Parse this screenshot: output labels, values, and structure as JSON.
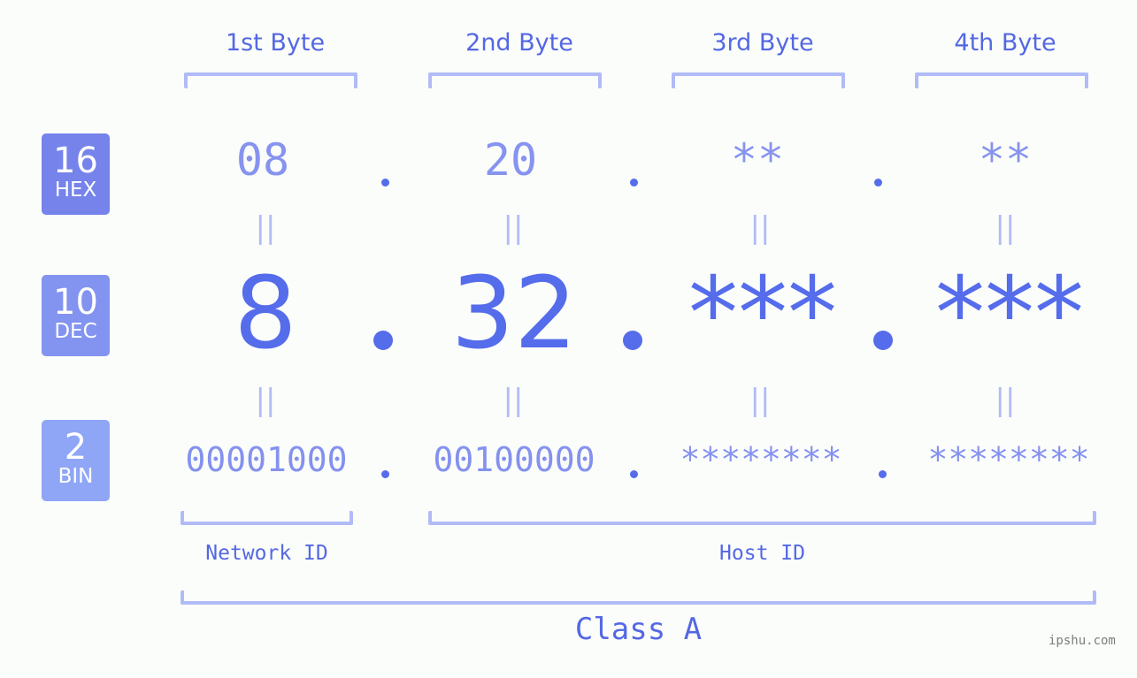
{
  "headers": [
    "1st Byte",
    "2nd Byte",
    "3rd Byte",
    "4th Byte"
  ],
  "bases": [
    {
      "number": "16",
      "label": "HEX",
      "color": "#7583eb"
    },
    {
      "number": "10",
      "label": "DEC",
      "color": "#8393f0"
    },
    {
      "number": "2",
      "label": "BIN",
      "color": "#8fa6f6"
    }
  ],
  "hex": [
    "08",
    "20",
    "**",
    "**"
  ],
  "dec": [
    "8",
    "32",
    "***",
    "***"
  ],
  "bin": [
    "00001000",
    "00100000",
    "********",
    "********"
  ],
  "equals_sign": "||",
  "network_label": "Network ID",
  "host_label": "Host ID",
  "class_label": "Class A",
  "watermark": "ipshu.com"
}
